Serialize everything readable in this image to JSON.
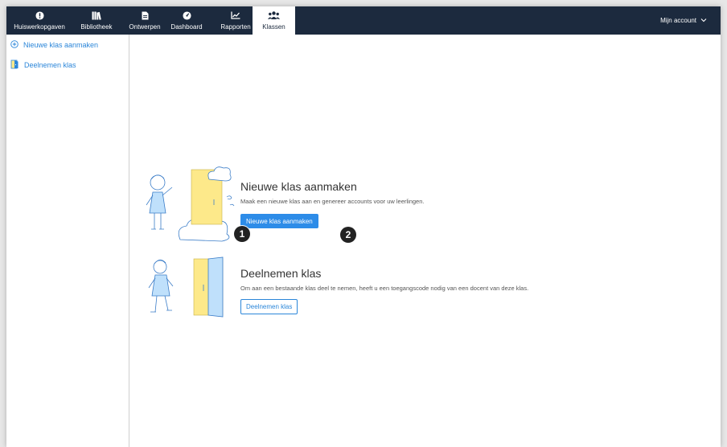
{
  "nav": {
    "items": [
      {
        "label": "Huiswerkopgaven",
        "icon": "alert-circle-icon"
      },
      {
        "label": "Bibliotheek",
        "icon": "library-icon"
      },
      {
        "label": "Ontwerpen",
        "icon": "document-icon"
      },
      {
        "label": "Dashboard",
        "icon": "gauge-icon"
      },
      {
        "label": "Rapporten",
        "icon": "line-chart-icon"
      },
      {
        "label": "Klassen",
        "icon": "users-icon",
        "active": true
      }
    ],
    "account_label": "Mijn account"
  },
  "sidebar": {
    "items": [
      {
        "label": "Nieuwe klas aanmaken",
        "icon": "plus-circle-icon"
      },
      {
        "label": "Deelnemen klas",
        "icon": "door-icon"
      }
    ]
  },
  "sections": {
    "create": {
      "title": "Nieuwe klas aanmaken",
      "description": "Maak een nieuwe klas aan en genereer accounts voor uw leerlingen.",
      "button_label": "Nieuwe klas aanmaken"
    },
    "join": {
      "title": "Deelnemen klas",
      "description": "Om aan een bestaande klas deel te nemen, heeft u een toegangscode nodig van een docent van deze klas.",
      "button_label": "Deelnemen klas"
    }
  },
  "markers": [
    "1",
    "2"
  ],
  "colors": {
    "nav_bg": "#1c2a3e",
    "accent": "#2d8ce8",
    "link": "#2b86d9",
    "door_yellow": "#fde98a",
    "door_blue": "#bfe0fb"
  }
}
